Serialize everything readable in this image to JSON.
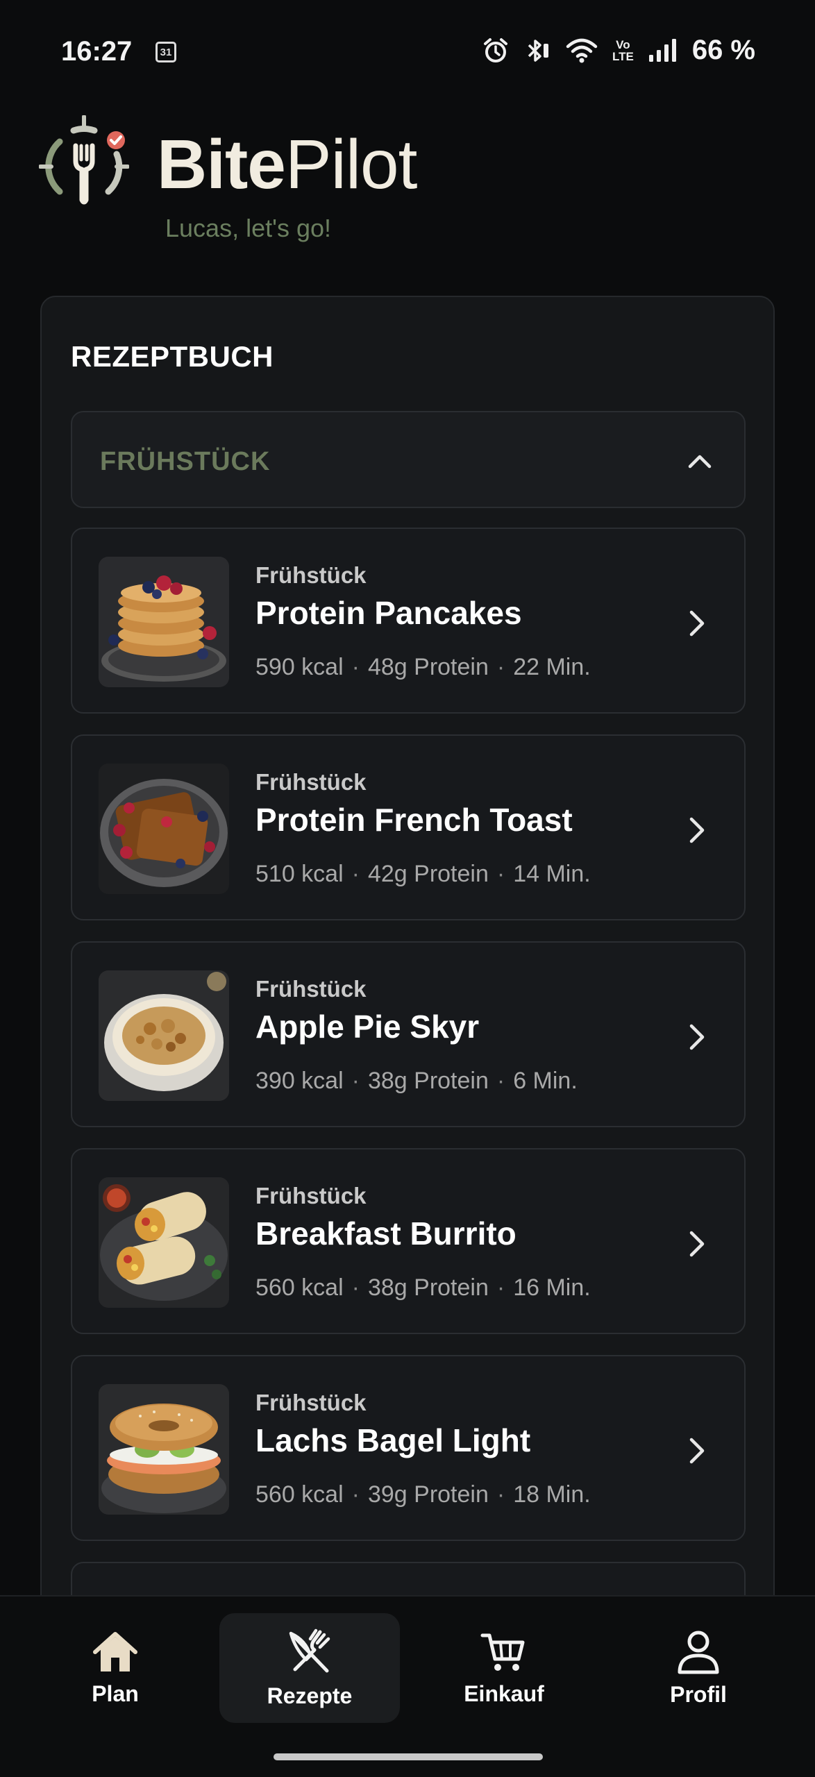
{
  "status_bar": {
    "time": "16:27",
    "calendar_day": "31",
    "volte_top": "Vo",
    "volte_bottom": "LTE",
    "battery": "66 %"
  },
  "header": {
    "title_bold": "Bite",
    "title_light": "Pilot",
    "greeting": "Lucas, let's go!"
  },
  "recipe_book": {
    "title": "REZEPTBUCH",
    "category": {
      "label": "FRÜHSTÜCK",
      "expanded": true
    },
    "recipes": [
      {
        "category": "Frühstück",
        "name": "Protein Pancakes",
        "kcal": "590 kcal",
        "protein": "48g Protein",
        "time": "22 Min."
      },
      {
        "category": "Frühstück",
        "name": "Protein French Toast",
        "kcal": "510 kcal",
        "protein": "42g Protein",
        "time": "14 Min."
      },
      {
        "category": "Frühstück",
        "name": "Apple Pie Skyr",
        "kcal": "390 kcal",
        "protein": "38g Protein",
        "time": "6 Min."
      },
      {
        "category": "Frühstück",
        "name": "Breakfast Burrito",
        "kcal": "560 kcal",
        "protein": "38g Protein",
        "time": "16 Min."
      },
      {
        "category": "Frühstück",
        "name": "Lachs Bagel Light",
        "kcal": "560 kcal",
        "protein": "39g Protein",
        "time": "18 Min."
      }
    ]
  },
  "bottom_nav": {
    "items": [
      {
        "label": "Plan",
        "icon": "home-icon"
      },
      {
        "label": "Rezepte",
        "icon": "fork-knife-icon",
        "active": true
      },
      {
        "label": "Einkauf",
        "icon": "cart-icon"
      },
      {
        "label": "Profil",
        "icon": "person-icon"
      }
    ]
  },
  "colors": {
    "background": "#0b0c0d",
    "card": "#151719",
    "accent_green": "#6b7a5c",
    "text": "#ffffff"
  }
}
